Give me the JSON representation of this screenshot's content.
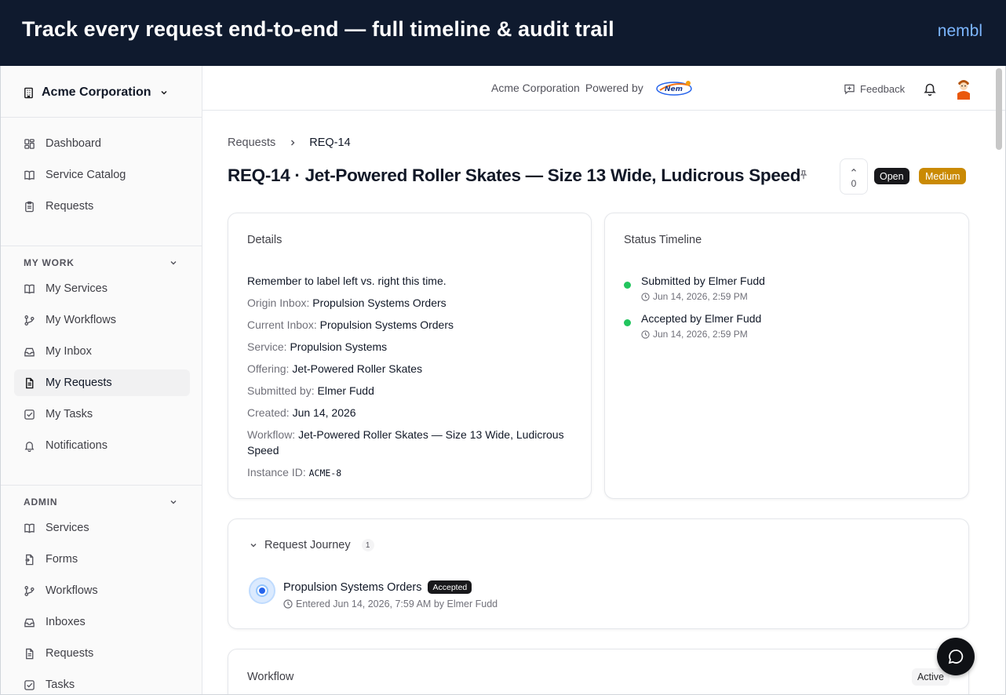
{
  "banner": {
    "headline": "Track every request end-to-end — full timeline & audit trail",
    "brand": "nembl"
  },
  "sidebar": {
    "org_name": "Acme Corporation",
    "top_items": [
      {
        "label": "Dashboard",
        "icon": "dashboard-icon"
      },
      {
        "label": "Service Catalog",
        "icon": "book-icon"
      },
      {
        "label": "Requests",
        "icon": "clipboard-icon"
      }
    ],
    "my_work": {
      "heading": "MY WORK",
      "items": [
        {
          "label": "My Services",
          "icon": "book-icon"
        },
        {
          "label": "My Workflows",
          "icon": "workflow-icon"
        },
        {
          "label": "My Inbox",
          "icon": "inbox-icon"
        },
        {
          "label": "My Requests",
          "icon": "document-icon",
          "active": true
        },
        {
          "label": "My Tasks",
          "icon": "task-check-icon"
        },
        {
          "label": "Notifications",
          "icon": "bell-icon"
        }
      ]
    },
    "admin": {
      "heading": "ADMIN",
      "items": [
        {
          "label": "Services",
          "icon": "book-icon"
        },
        {
          "label": "Forms",
          "icon": "form-icon"
        },
        {
          "label": "Workflows",
          "icon": "workflow-icon"
        },
        {
          "label": "Inboxes",
          "icon": "inbox-icon"
        },
        {
          "label": "Requests",
          "icon": "document-icon"
        },
        {
          "label": "Tasks",
          "icon": "task-check-icon"
        }
      ]
    }
  },
  "topbar": {
    "org_name": "Acme Corporation",
    "powered_by": "Powered by",
    "feedback_label": "Feedback"
  },
  "breadcrumb": {
    "parent": "Requests",
    "current": "REQ-14"
  },
  "request": {
    "title": "REQ-14 · Jet-Powered Roller Skates — Size 13 Wide, Ludicrous Speed",
    "vote_count": "0",
    "status": "Open",
    "priority": "Medium",
    "status_color": "#18181b",
    "priority_color": "#ca8a04"
  },
  "details": {
    "heading": "Details",
    "note": "Remember to label left vs. right this time.",
    "origin_inbox": {
      "label": "Origin Inbox:",
      "value": "Propulsion Systems Orders"
    },
    "current_inbox": {
      "label": "Current Inbox:",
      "value": "Propulsion Systems Orders"
    },
    "service": {
      "label": "Service:",
      "value": "Propulsion Systems"
    },
    "offering": {
      "label": "Offering:",
      "value": "Jet-Powered Roller Skates"
    },
    "submitted_by": {
      "label": "Submitted by:",
      "value": "Elmer Fudd"
    },
    "created": {
      "label": "Created:",
      "value": "Jun 14, 2026"
    },
    "workflow": {
      "label": "Workflow:",
      "value": "Jet-Powered Roller Skates — Size 13 Wide, Ludicrous Speed"
    },
    "instance_id": {
      "label": "Instance ID:",
      "value": "ACME-8"
    }
  },
  "timeline": {
    "heading": "Status Timeline",
    "dot_color": "#22c55e",
    "events": [
      {
        "text": "Submitted by Elmer Fudd",
        "time": "Jun 14, 2026, 2:59 PM"
      },
      {
        "text": "Accepted by Elmer Fudd",
        "time": "Jun 14, 2026, 2:59 PM"
      }
    ]
  },
  "journey": {
    "heading": "Request Journey",
    "count": "1",
    "stops": [
      {
        "name": "Propulsion Systems Orders",
        "status": "Accepted",
        "entered": "Entered Jun 14, 2026, 7:59 AM by Elmer Fudd"
      }
    ]
  },
  "workflow_card": {
    "heading": "Workflow",
    "status": "Active"
  }
}
